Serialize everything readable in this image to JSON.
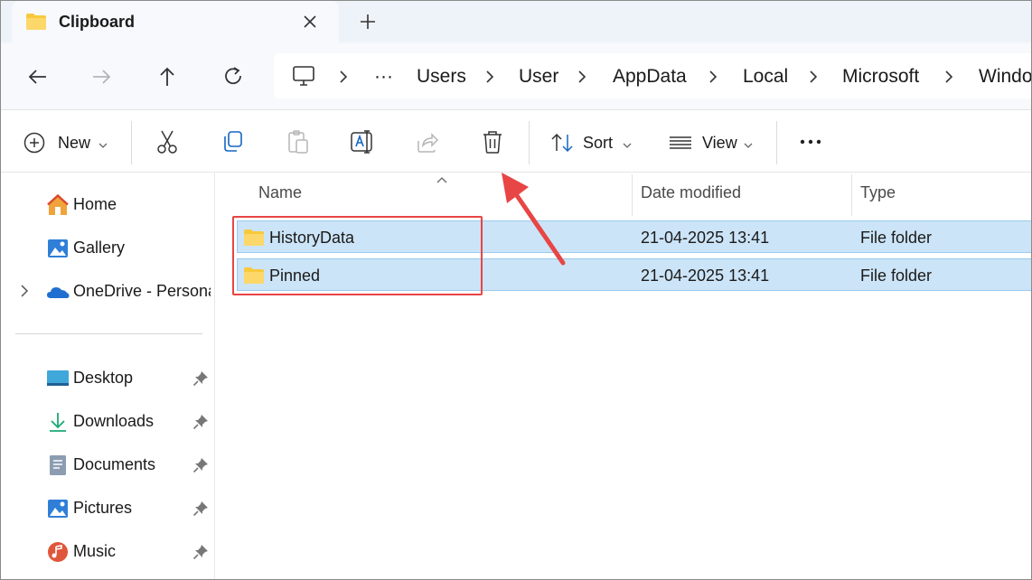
{
  "window": {
    "tab_title": "Clipboard",
    "close_tab_label": "✕",
    "new_tab_label": "+"
  },
  "address_bar": {
    "segments": [
      "Users",
      "User",
      "AppData",
      "Local",
      "Microsoft",
      "Windo"
    ],
    "overflow_label": "···"
  },
  "command_bar": {
    "new_label": "New",
    "sort_label": "Sort",
    "view_label": "View",
    "more_label": "•••"
  },
  "nav_pane": {
    "top_items": [
      {
        "label": "Home",
        "icon": "home-icon"
      },
      {
        "label": "Gallery",
        "icon": "gallery-icon"
      },
      {
        "label": "OneDrive - Personal",
        "icon": "onedrive-icon"
      }
    ],
    "quick_access": [
      {
        "label": "Desktop",
        "icon": "desktop-icon"
      },
      {
        "label": "Downloads",
        "icon": "downloads-icon"
      },
      {
        "label": "Documents",
        "icon": "documents-icon"
      },
      {
        "label": "Pictures",
        "icon": "pictures-icon"
      },
      {
        "label": "Music",
        "icon": "music-icon"
      }
    ]
  },
  "file_list": {
    "columns": [
      "Name",
      "Date modified",
      "Type"
    ],
    "rows": [
      {
        "name": "HistoryData",
        "date": "21-04-2025 13:41",
        "type": "File folder",
        "selected": true
      },
      {
        "name": "Pinned",
        "date": "21-04-2025 13:41",
        "type": "File folder",
        "selected": true
      }
    ]
  },
  "colors": {
    "selection_bg": "#cce4f7",
    "selection_border": "#99c9ef",
    "annotation_red": "#e84545",
    "folder_yellow": "#f8c93d"
  }
}
